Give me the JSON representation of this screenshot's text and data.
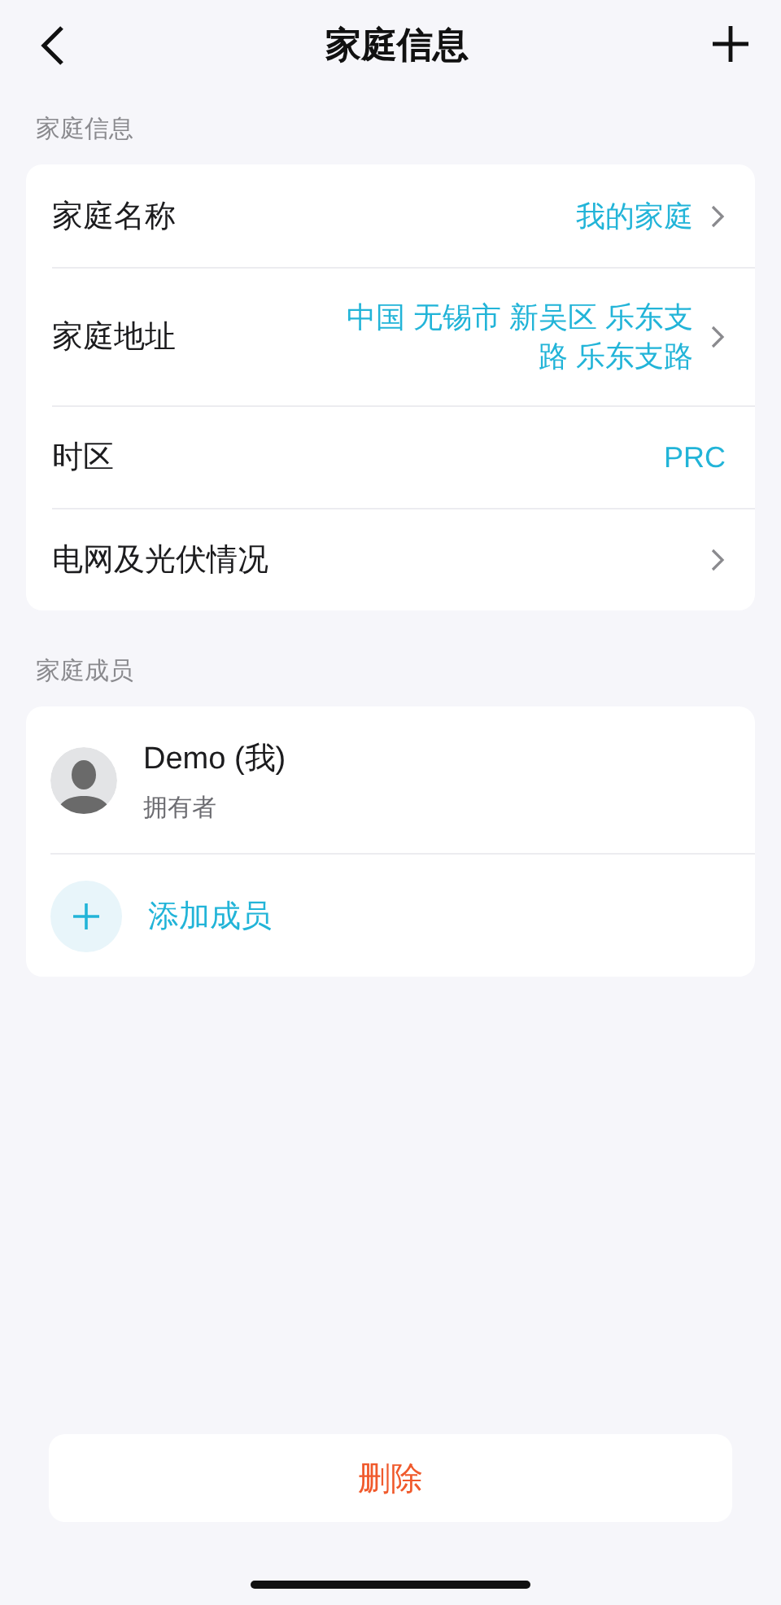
{
  "header": {
    "title": "家庭信息"
  },
  "info_section": {
    "label": "家庭信息",
    "rows": [
      {
        "label": "家庭名称",
        "value": "我的家庭",
        "chevron": true
      },
      {
        "label": "家庭地址",
        "value": "中国 无锡市 新吴区 乐东支路 乐东支路",
        "chevron": true
      },
      {
        "label": "时区",
        "value": "PRC",
        "chevron": false
      },
      {
        "label": "电网及光伏情况",
        "chevron": true
      }
    ]
  },
  "members_section": {
    "label": "家庭成员",
    "members": [
      {
        "name": "Demo (我)",
        "role": "拥有者"
      }
    ],
    "add_member": "添加成员"
  },
  "delete_button": "删除"
}
